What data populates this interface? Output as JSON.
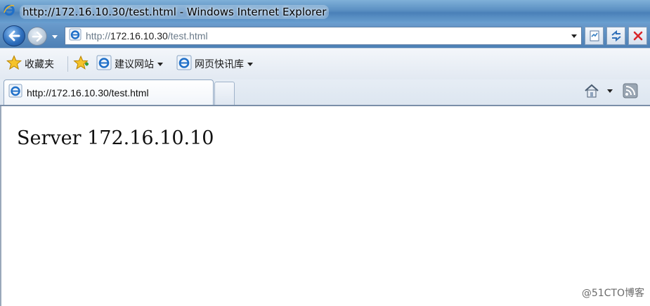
{
  "window": {
    "title": "http://172.16.10.30/test.html - Windows Internet Explorer"
  },
  "address_bar": {
    "url_prefix": "http://",
    "url_host": "172.16.10.30",
    "url_path": "/test.html"
  },
  "favorites_bar": {
    "favorites_label": "收藏夹",
    "items": [
      {
        "label": "建议网站"
      },
      {
        "label": "网页快讯库"
      }
    ]
  },
  "tabs": [
    {
      "label": "http://172.16.10.30/test.html",
      "active": true
    }
  ],
  "page": {
    "content_text": "Server 172.16.10.10"
  },
  "watermark": "@51CTO博客",
  "colors": {
    "titlebar": "#5a8fc2",
    "ie_blue": "#1f6fc8",
    "stop_red": "#d8262a"
  }
}
